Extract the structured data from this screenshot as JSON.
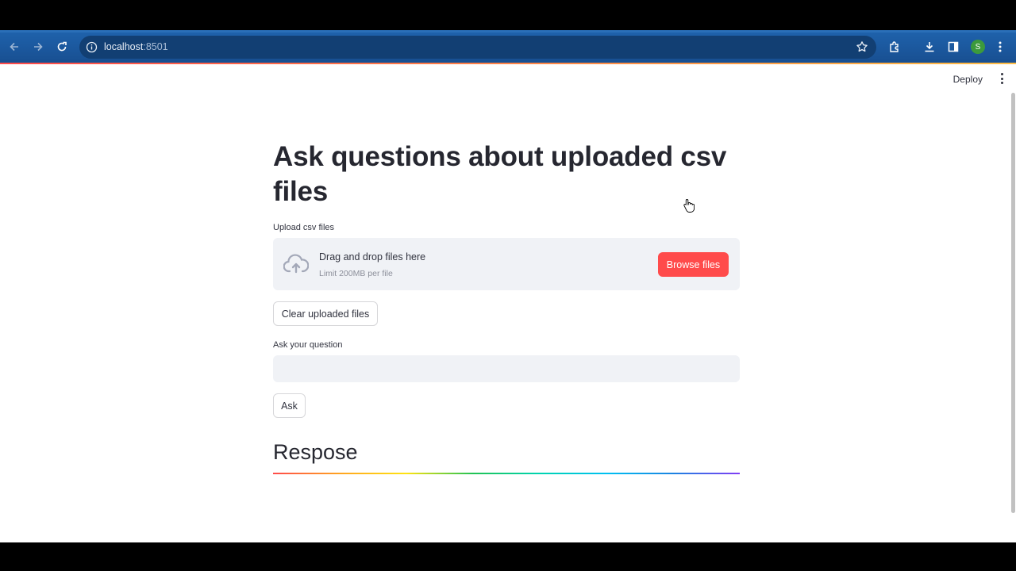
{
  "browser": {
    "url_host": "localhost",
    "url_port": ":8501",
    "profile_initial": "S"
  },
  "header": {
    "deploy_label": "Deploy"
  },
  "main": {
    "title": "Ask questions about uploaded csv files",
    "upload_label": "Upload csv files",
    "dropzone_text": "Drag and drop files here",
    "dropzone_limit": "Limit 200MB per file",
    "browse_label": "Browse files",
    "clear_label": "Clear uploaded files",
    "question_label": "Ask your question",
    "question_value": "",
    "ask_label": "Ask",
    "response_header": "Respose"
  },
  "colors": {
    "primary": "#ff4b4b",
    "chrome": "#1c5fa8",
    "input_bg": "#f0f2f6",
    "text": "#31333f"
  },
  "icons": [
    "back-arrow-icon",
    "forward-arrow-icon",
    "reload-icon",
    "info-icon",
    "star-icon",
    "extensions-icon",
    "download-icon",
    "side-panel-icon",
    "kebab-menu-icon",
    "cloud-upload-icon",
    "hand-cursor-icon"
  ]
}
